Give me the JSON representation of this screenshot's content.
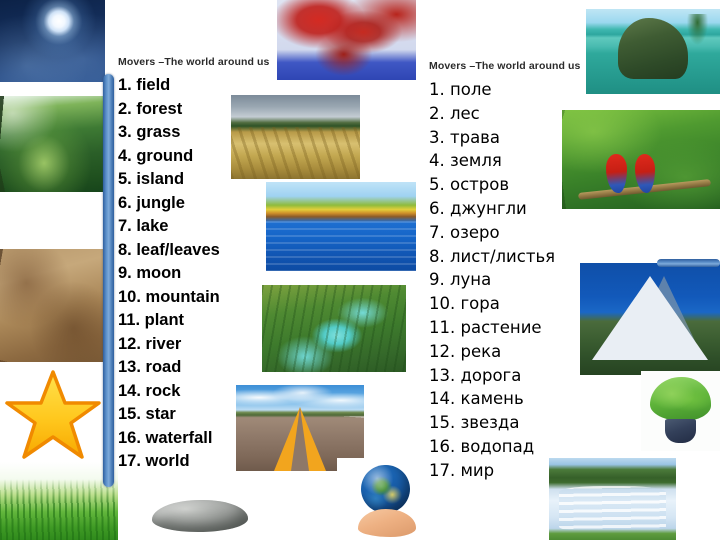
{
  "slide": {
    "background_color": "#ffffff",
    "accent_color": "#5b8fc9"
  },
  "english_column": {
    "title": "Movers –The world around us",
    "words": [
      "1. field",
      "2. forest",
      "3. grass",
      "4. ground",
      "5. island",
      "6. jungle",
      "7. lake",
      "8. leaf/leaves",
      "9. moon",
      "10. mountain",
      "11. plant",
      "12. river",
      "13. road",
      "14. rock",
      "15. star",
      "16. waterfall",
      "17. world"
    ]
  },
  "russian_column": {
    "title": "Movers –The world around us",
    "words": [
      "1. поле",
      "2. лес",
      "3. трава",
      "4. земля",
      "5. остров",
      "6. джунгли",
      "7. озеро",
      "8. лист/листья",
      "9. луна",
      "10. гора",
      "11. растение",
      "12. река",
      "13. дорога",
      "14. камень",
      "15. звезда",
      "16. водопад",
      "17. мир"
    ]
  },
  "images": [
    {
      "name": "moon-photo",
      "label": "moon"
    },
    {
      "name": "forest-photo",
      "label": "forest"
    },
    {
      "name": "ground-photo",
      "label": "ground"
    },
    {
      "name": "star-graphic",
      "label": "star"
    },
    {
      "name": "grass-photo",
      "label": "grass"
    },
    {
      "name": "leaves-photo",
      "label": "leaf/leaves"
    },
    {
      "name": "field-photo",
      "label": "field"
    },
    {
      "name": "lake-photo",
      "label": "lake"
    },
    {
      "name": "river-photo",
      "label": "river"
    },
    {
      "name": "road-photo",
      "label": "road"
    },
    {
      "name": "rock-photo",
      "label": "rock"
    },
    {
      "name": "world-photo",
      "label": "world"
    },
    {
      "name": "island-photo",
      "label": "island"
    },
    {
      "name": "jungle-photo",
      "label": "jungle"
    },
    {
      "name": "mountain-photo",
      "label": "mountain"
    },
    {
      "name": "plant-photo",
      "label": "plant"
    },
    {
      "name": "waterfall-photo",
      "label": "waterfall"
    }
  ]
}
